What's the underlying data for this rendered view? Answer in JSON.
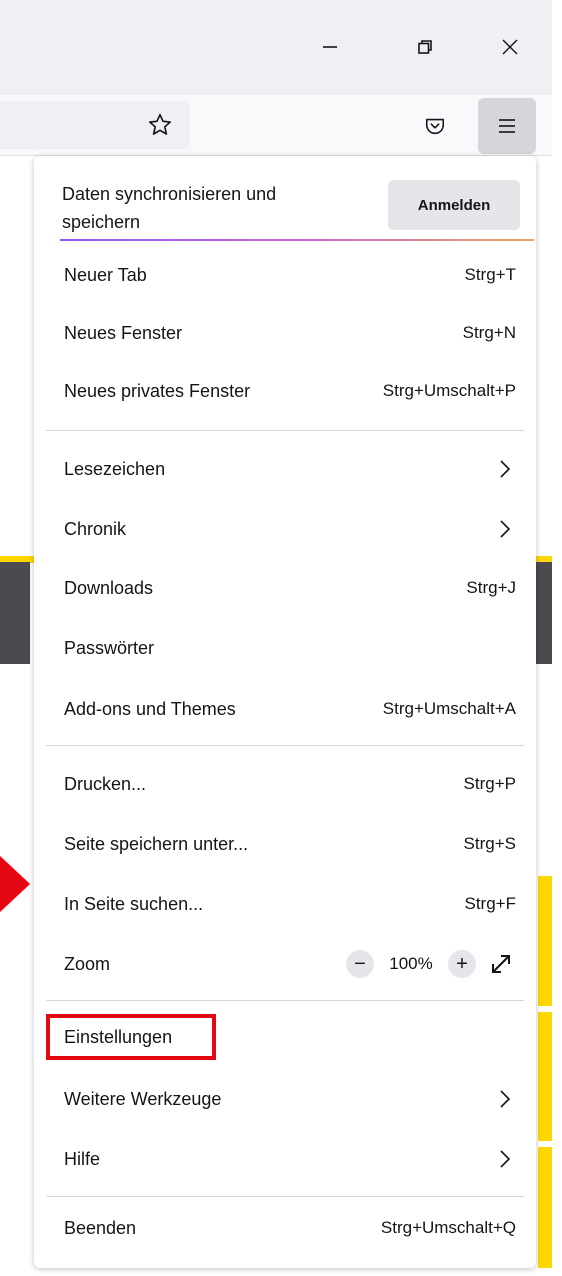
{
  "window": {
    "minimize_icon": "minimize-icon",
    "restore_icon": "restore-icon",
    "close_icon": "close-icon"
  },
  "toolbar": {
    "bookmark_icon": "star-icon",
    "pocket_icon": "pocket-icon",
    "menu_icon": "hamburger-icon"
  },
  "sync": {
    "text": "Daten synchronisieren und speichern",
    "button_label": "Anmelden"
  },
  "menu": {
    "new_tab": {
      "label": "Neuer Tab",
      "shortcut": "Strg+T"
    },
    "new_window": {
      "label": "Neues Fenster",
      "shortcut": "Strg+N"
    },
    "new_private_window": {
      "label": "Neues privates Fenster",
      "shortcut": "Strg+Umschalt+P"
    },
    "bookmarks": {
      "label": "Lesezeichen"
    },
    "history": {
      "label": "Chronik"
    },
    "downloads": {
      "label": "Downloads",
      "shortcut": "Strg+J"
    },
    "passwords": {
      "label": "Passwörter"
    },
    "addons": {
      "label": "Add-ons und Themes",
      "shortcut": "Strg+Umschalt+A"
    },
    "print": {
      "label": "Drucken...",
      "shortcut": "Strg+P"
    },
    "save_page": {
      "label": "Seite speichern unter...",
      "shortcut": "Strg+S"
    },
    "find": {
      "label": "In Seite suchen...",
      "shortcut": "Strg+F"
    },
    "zoom": {
      "label": "Zoom",
      "minus": "−",
      "value": "100%",
      "plus": "+"
    },
    "settings": {
      "label": "Einstellungen"
    },
    "more_tools": {
      "label": "Weitere Werkzeuge"
    },
    "help": {
      "label": "Hilfe"
    },
    "quit": {
      "label": "Beenden",
      "shortcut": "Strg+Umschalt+Q"
    }
  },
  "colors": {
    "highlight": "#e30613",
    "accent_yellow": "#ffd600"
  }
}
